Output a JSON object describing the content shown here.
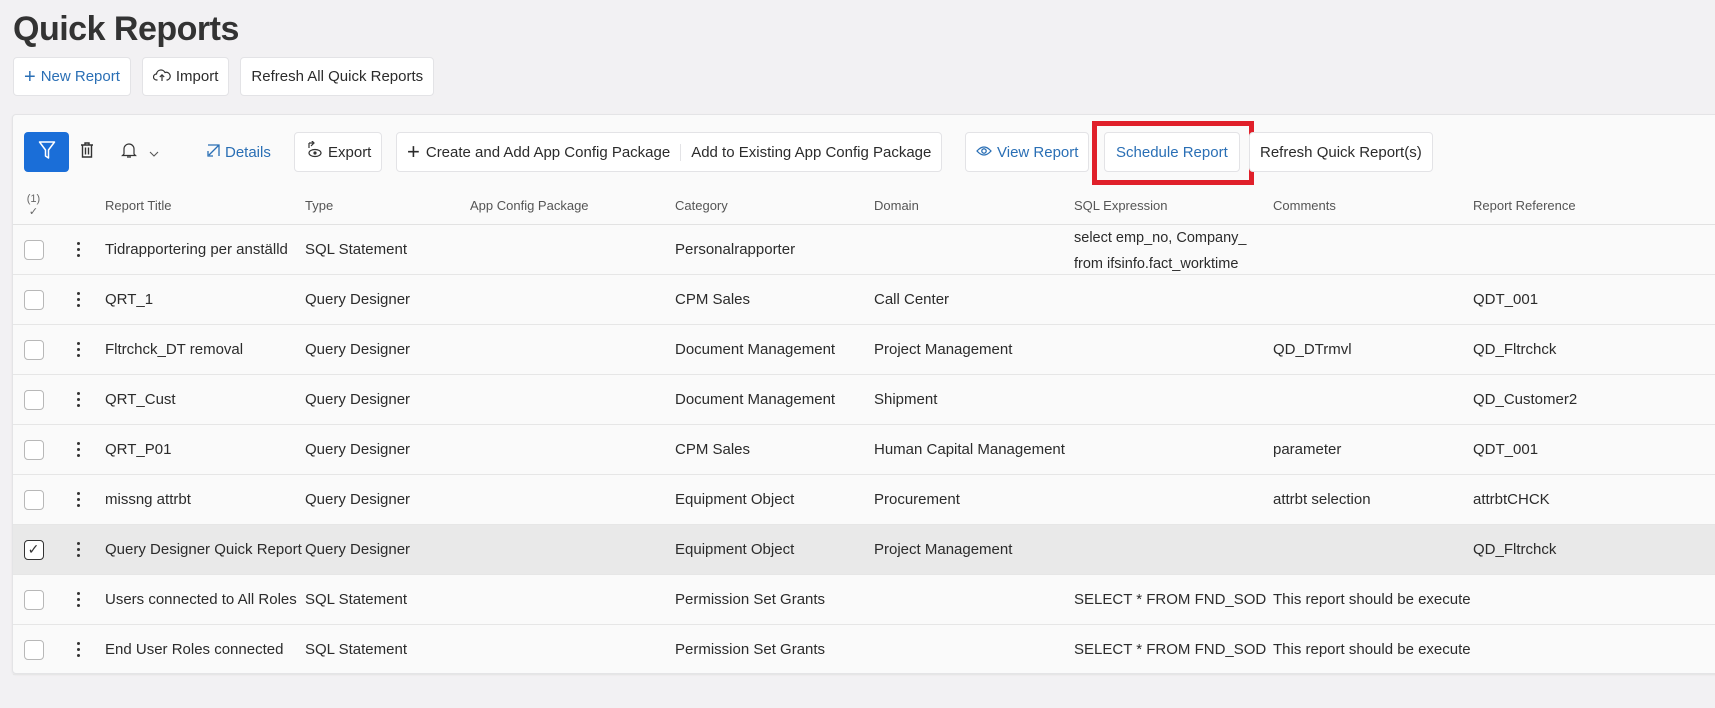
{
  "page": {
    "title": "Quick Reports"
  },
  "top_actions": {
    "new_report": "New Report",
    "import": "Import",
    "refresh_all": "Refresh All Quick Reports"
  },
  "toolbar": {
    "details": "Details",
    "export": "Export",
    "create_add_package": "Create and Add App Config Package",
    "add_existing_package": "Add to Existing App Config Package",
    "view_report": "View Report",
    "schedule_report": "Schedule Report",
    "refresh_quick_reports": "Refresh Quick Report(s)"
  },
  "colors": {
    "accent": "#1a6ed8",
    "link": "#2a6fb5",
    "highlight": "#e0202a"
  },
  "table": {
    "selection_count": "(1)",
    "columns": [
      "Report Title",
      "Type",
      "App Config Package",
      "Category",
      "Domain",
      "SQL Expression",
      "Comments",
      "Report Reference"
    ],
    "rows": [
      {
        "selected": false,
        "title": "Tidrapportering per anställd",
        "type": "SQL Statement",
        "app": "",
        "category": "Personalrapporter",
        "domain": "",
        "sql": "select emp_no, Company_",
        "sql2": "from ifsinfo.fact_worktime",
        "comments": "",
        "ref": ""
      },
      {
        "selected": false,
        "title": "QRT_1",
        "type": "Query Designer",
        "app": "",
        "category": "CPM Sales",
        "domain": "Call Center",
        "sql": "",
        "comments": "",
        "ref": "QDT_001"
      },
      {
        "selected": false,
        "title": "Fltrchck_DT removal",
        "type": "Query Designer",
        "app": "",
        "category": "Document Management",
        "domain": "Project Management",
        "sql": "",
        "comments": "QD_DTrmvl",
        "ref": "QD_Fltrchck"
      },
      {
        "selected": false,
        "title": "QRT_Cust",
        "type": "Query Designer",
        "app": "",
        "category": "Document Management",
        "domain": "Shipment",
        "sql": "",
        "comments": "",
        "ref": "QD_Customer2"
      },
      {
        "selected": false,
        "title": "QRT_P01",
        "type": "Query Designer",
        "app": "",
        "category": "CPM Sales",
        "domain": "Human Capital Management",
        "sql": "",
        "comments": "parameter",
        "ref": "QDT_001"
      },
      {
        "selected": false,
        "title": "missng attrbt",
        "type": "Query Designer",
        "app": "",
        "category": "Equipment Object",
        "domain": "Procurement",
        "sql": "",
        "comments": "attrbt selection",
        "ref": "attrbtCHCK"
      },
      {
        "selected": true,
        "title": "Query Designer Quick Report",
        "type": "Query Designer",
        "app": "",
        "category": "Equipment Object",
        "domain": "Project Management",
        "sql": "",
        "comments": "",
        "ref": "QD_Fltrchck"
      },
      {
        "selected": false,
        "title": "Users connected to All Roles",
        "type": "SQL Statement",
        "app": "",
        "category": "Permission Set Grants",
        "domain": "",
        "sql": "SELECT * FROM FND_SOD",
        "comments": "This report should be executed",
        "ref": ""
      },
      {
        "selected": false,
        "title": "End User Roles connected",
        "type": "SQL Statement",
        "app": "",
        "category": "Permission Set Grants",
        "domain": "",
        "sql": "SELECT * FROM FND_SOD",
        "comments": "This report should be executed",
        "ref": ""
      }
    ]
  }
}
